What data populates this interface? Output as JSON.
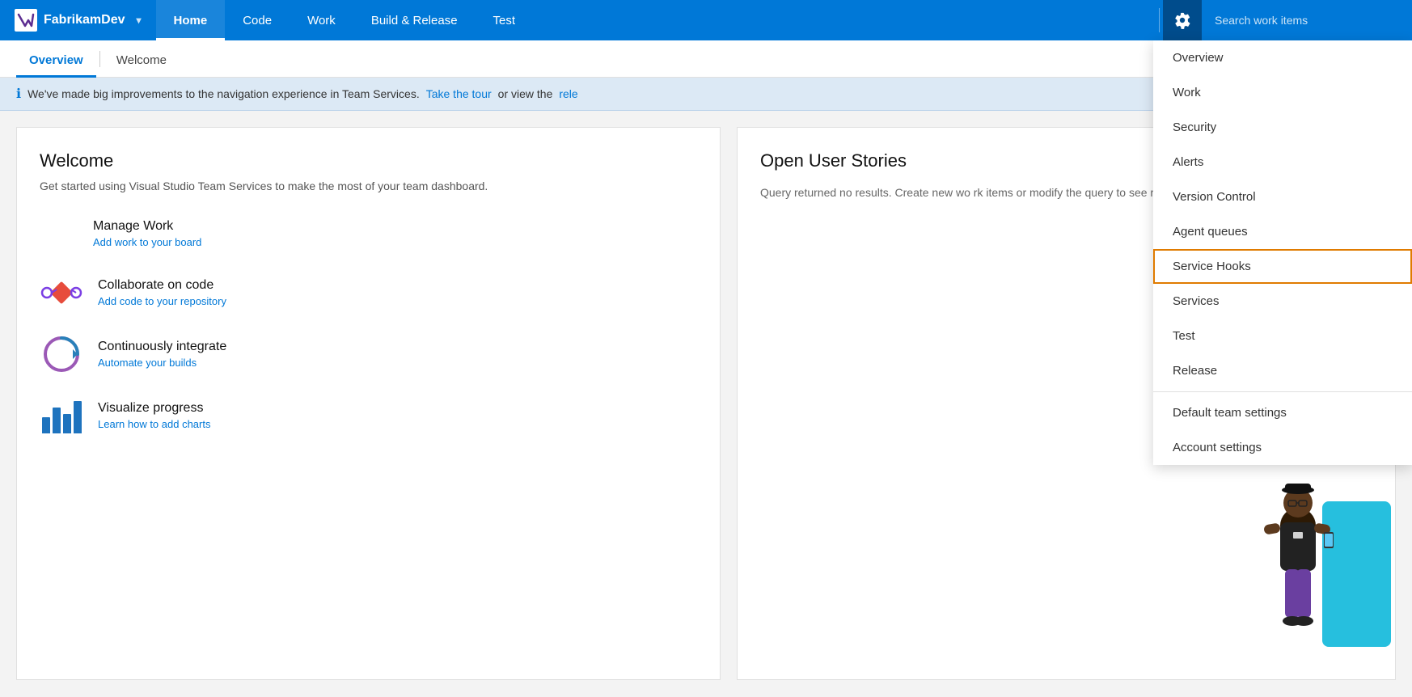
{
  "brand": {
    "logo_alt": "Visual Studio",
    "name": "FabrikamDev"
  },
  "nav": {
    "links": [
      {
        "id": "home",
        "label": "Home",
        "active": true
      },
      {
        "id": "code",
        "label": "Code",
        "active": false
      },
      {
        "id": "work",
        "label": "Work",
        "active": false
      },
      {
        "id": "build-release",
        "label": "Build & Release",
        "active": false
      },
      {
        "id": "test",
        "label": "Test",
        "active": false
      }
    ],
    "search_placeholder": "Search work items"
  },
  "dropdown": {
    "items": [
      {
        "id": "overview",
        "label": "Overview",
        "highlighted": false,
        "divider_after": false
      },
      {
        "id": "work",
        "label": "Work",
        "highlighted": false,
        "divider_after": false
      },
      {
        "id": "security",
        "label": "Security",
        "highlighted": false,
        "divider_after": false
      },
      {
        "id": "alerts",
        "label": "Alerts",
        "highlighted": false,
        "divider_after": false
      },
      {
        "id": "version-control",
        "label": "Version Control",
        "highlighted": false,
        "divider_after": false
      },
      {
        "id": "agent-queues",
        "label": "Agent queues",
        "highlighted": false,
        "divider_after": false
      },
      {
        "id": "service-hooks",
        "label": "Service Hooks",
        "highlighted": true,
        "divider_after": false
      },
      {
        "id": "services",
        "label": "Services",
        "highlighted": false,
        "divider_after": false
      },
      {
        "id": "test",
        "label": "Test",
        "highlighted": false,
        "divider_after": false
      },
      {
        "id": "release",
        "label": "Release",
        "highlighted": false,
        "divider_after": true
      },
      {
        "id": "default-team-settings",
        "label": "Default team settings",
        "highlighted": false,
        "divider_after": false
      },
      {
        "id": "account-settings",
        "label": "Account settings",
        "highlighted": false,
        "divider_after": false
      }
    ]
  },
  "subtabs": [
    {
      "id": "overview",
      "label": "Overview",
      "active": true
    },
    {
      "id": "welcome",
      "label": "Welcome",
      "active": false
    }
  ],
  "infobar": {
    "message": "We've made big improvements to the navigation experience in Team Services.",
    "link1_text": "Take the tour",
    "link2_prefix": "or view the",
    "link2_text": "rele"
  },
  "welcome_card": {
    "title": "Welcome",
    "subtitle": "Get started using Visual Studio Team Services to make the most of your team dashboard.",
    "items": [
      {
        "id": "manage-work",
        "title": "Manage Work",
        "link": "Add work to your board"
      },
      {
        "id": "collaborate-code",
        "title": "Collaborate on code",
        "link": "Add code to your repository"
      },
      {
        "id": "continuously-integrate",
        "title": "Continuously integrate",
        "link": "Automate your builds"
      },
      {
        "id": "visualize-progress",
        "title": "Visualize progress",
        "link": "Learn how to add charts"
      }
    ]
  },
  "stories_card": {
    "title": "Open User Stories",
    "empty_message": "Query returned no results. Create new wo rk items or modify the query to see results."
  }
}
